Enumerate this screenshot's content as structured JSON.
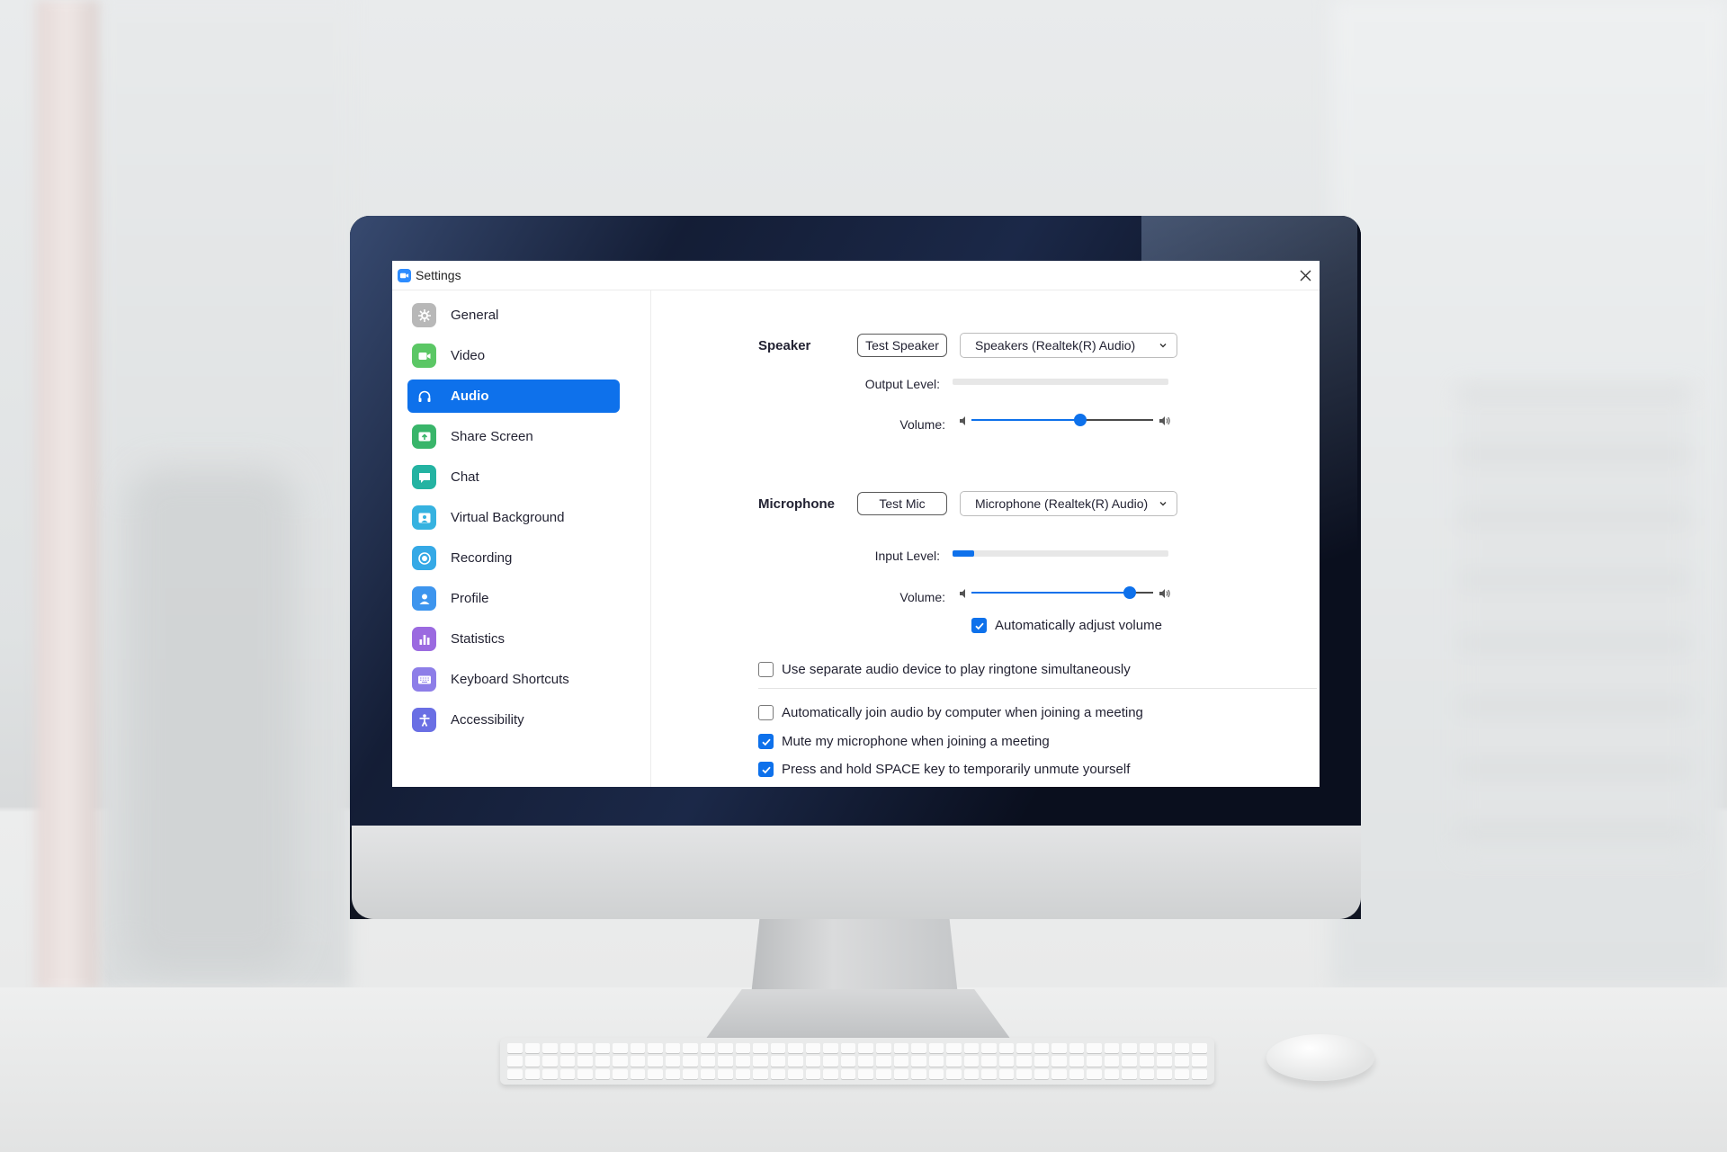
{
  "window": {
    "title": "Settings",
    "close_icon": "close-icon"
  },
  "sidebar": {
    "items": [
      {
        "label": "General",
        "icon": "gear-icon",
        "color": "#b8b8b8",
        "active": false
      },
      {
        "label": "Video",
        "icon": "video-camera-icon",
        "color": "#5bc765",
        "active": false
      },
      {
        "label": "Audio",
        "icon": "headphones-icon",
        "color": "#0e71eb",
        "active": true
      },
      {
        "label": "Share Screen",
        "icon": "share-screen-icon",
        "color": "#39b56a",
        "active": false
      },
      {
        "label": "Chat",
        "icon": "chat-bubble-icon",
        "color": "#24b3a2",
        "active": false
      },
      {
        "label": "Virtual Background",
        "icon": "person-background-icon",
        "color": "#36b2e0",
        "active": false
      },
      {
        "label": "Recording",
        "icon": "record-icon",
        "color": "#35a9e6",
        "active": false
      },
      {
        "label": "Profile",
        "icon": "person-icon",
        "color": "#3d95ee",
        "active": false
      },
      {
        "label": "Statistics",
        "icon": "bar-chart-icon",
        "color": "#9b6ae0",
        "active": false
      },
      {
        "label": "Keyboard Shortcuts",
        "icon": "keyboard-icon",
        "color": "#8d7ee8",
        "active": false
      },
      {
        "label": "Accessibility",
        "icon": "accessibility-icon",
        "color": "#6a6fe4",
        "active": false
      }
    ]
  },
  "speaker": {
    "section_label": "Speaker",
    "test_button": "Test Speaker",
    "device": "Speakers (Realtek(R) Audio)",
    "output_level_label": "Output Level:",
    "output_level": 0.0,
    "volume_label": "Volume:",
    "volume": 0.6
  },
  "microphone": {
    "section_label": "Microphone",
    "test_button": "Test Mic",
    "device": "Microphone (Realtek(R) Audio)",
    "input_level_label": "Input Level:",
    "input_level": 0.1,
    "volume_label": "Volume:",
    "volume": 0.87,
    "auto_adjust_label": "Automatically adjust volume",
    "auto_adjust_checked": true
  },
  "options": [
    {
      "label": "Use separate audio device to play ringtone simultaneously",
      "checked": false
    },
    {
      "label": "Automatically join audio by computer when joining a meeting",
      "checked": false
    },
    {
      "label": "Mute my microphone when joining a meeting",
      "checked": true
    },
    {
      "label": "Press and hold SPACE key to temporarily unmute yourself",
      "checked": true
    }
  ],
  "colors": {
    "accent": "#0e71eb",
    "app_icon": "#2d8cff"
  }
}
